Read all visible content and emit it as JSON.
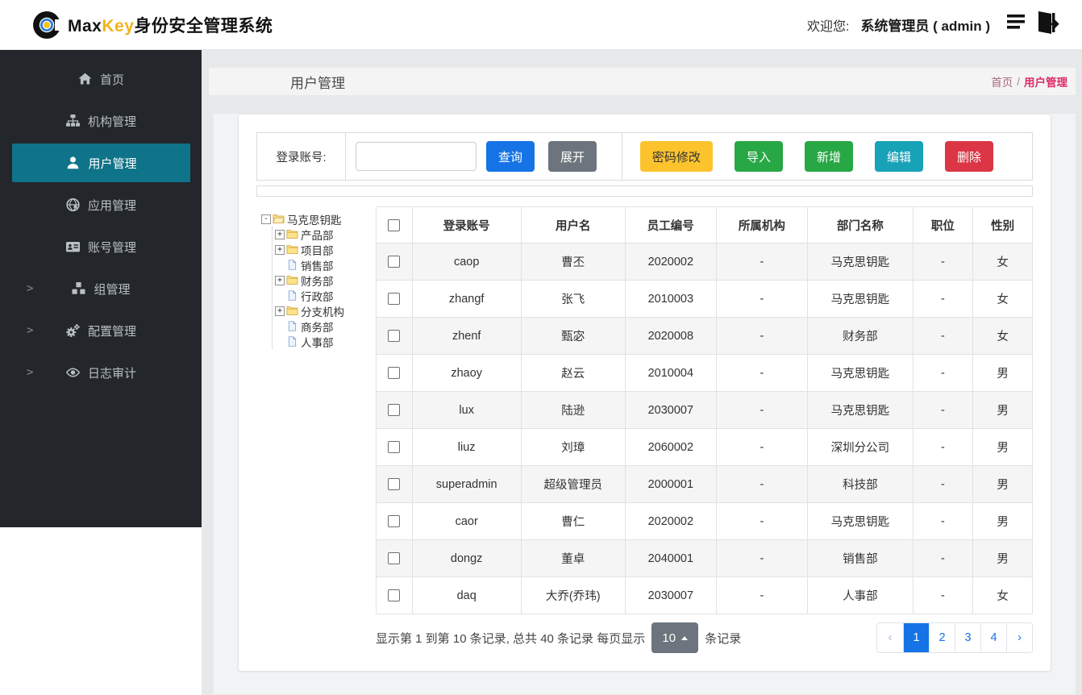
{
  "header": {
    "brand_max": "Max",
    "brand_key": "Key",
    "brand_suffix": "身份安全管理系统",
    "welcome_label": "欢迎您:",
    "user_display": "系统管理员 ( admin )",
    "brand_key_color": "#f2b31c"
  },
  "sidebar": {
    "active_bg": "#0f7489",
    "items": [
      {
        "id": "home",
        "label": "首页",
        "icon": "home-icon",
        "active": false,
        "chevron": false
      },
      {
        "id": "org",
        "label": "机构管理",
        "icon": "sitemap-icon",
        "active": false,
        "chevron": false
      },
      {
        "id": "user",
        "label": "用户管理",
        "icon": "user-icon",
        "active": true,
        "chevron": false
      },
      {
        "id": "app",
        "label": "应用管理",
        "icon": "globe-icon",
        "active": false,
        "chevron": false
      },
      {
        "id": "account",
        "label": "账号管理",
        "icon": "id-card-icon",
        "active": false,
        "chevron": false
      },
      {
        "id": "group",
        "label": "组管理",
        "icon": "cubes-icon",
        "active": false,
        "chevron": true
      },
      {
        "id": "config",
        "label": "配置管理",
        "icon": "gears-icon",
        "active": false,
        "chevron": true
      },
      {
        "id": "audit",
        "label": "日志审计",
        "icon": "eye-icon",
        "active": false,
        "chevron": true
      }
    ]
  },
  "page": {
    "title": "用户管理",
    "breadcrumb": {
      "home": "首页",
      "sep": "/",
      "current": "用户管理",
      "current_color": "#e02a66"
    }
  },
  "search": {
    "label": "登录账号:",
    "input_value": "",
    "query_label": "查询",
    "query_color": "#1673e6",
    "expand_label": "展开",
    "expand_color": "#6c757d",
    "actions": [
      {
        "id": "change-password",
        "label": "密码修改",
        "bg": "#fcc32d",
        "fg": "#333333"
      },
      {
        "id": "import",
        "label": "导入",
        "bg": "#28a745",
        "fg": "#ffffff"
      },
      {
        "id": "add",
        "label": "新增",
        "bg": "#28a745",
        "fg": "#ffffff"
      },
      {
        "id": "edit",
        "label": "编辑",
        "bg": "#17a2b8",
        "fg": "#ffffff"
      },
      {
        "id": "delete",
        "label": "删除",
        "bg": "#dc3545",
        "fg": "#ffffff"
      }
    ]
  },
  "tree": {
    "root": {
      "label": "马克思钥匙",
      "type": "folder-open",
      "toggle": "-"
    },
    "children": [
      {
        "label": "产品部",
        "type": "folder",
        "toggle": "+"
      },
      {
        "label": "项目部",
        "type": "folder",
        "toggle": "+"
      },
      {
        "label": "销售部",
        "type": "file",
        "toggle": ""
      },
      {
        "label": "财务部",
        "type": "folder",
        "toggle": "+"
      },
      {
        "label": "行政部",
        "type": "file",
        "toggle": ""
      },
      {
        "label": "分支机构",
        "type": "folder",
        "toggle": "+"
      },
      {
        "label": "商务部",
        "type": "file",
        "toggle": ""
      },
      {
        "label": "人事部",
        "type": "file",
        "toggle": ""
      }
    ]
  },
  "table": {
    "columns": [
      "登录账号",
      "用户名",
      "员工编号",
      "所属机构",
      "部门名称",
      "职位",
      "性别"
    ],
    "rows": [
      [
        "caop",
        "曹丕",
        "2020002",
        "-",
        "马克思钥匙",
        "-",
        "女"
      ],
      [
        "zhangf",
        "张飞",
        "2010003",
        "-",
        "马克思钥匙",
        "-",
        "女"
      ],
      [
        "zhenf",
        "甄宓",
        "2020008",
        "-",
        "财务部",
        "-",
        "女"
      ],
      [
        "zhaoy",
        "赵云",
        "2010004",
        "-",
        "马克思钥匙",
        "-",
        "男"
      ],
      [
        "lux",
        "陆逊",
        "2030007",
        "-",
        "马克思钥匙",
        "-",
        "男"
      ],
      [
        "liuz",
        "刘璋",
        "2060002",
        "-",
        "深圳分公司",
        "-",
        "男"
      ],
      [
        "superadmin",
        "超级管理员",
        "2000001",
        "-",
        "科技部",
        "-",
        "男"
      ],
      [
        "caor",
        "曹仁",
        "2020002",
        "-",
        "马克思钥匙",
        "-",
        "男"
      ],
      [
        "dongz",
        "董卓",
        "2040001",
        "-",
        "销售部",
        "-",
        "男"
      ],
      [
        "daq",
        "大乔(乔玮)",
        "2030007",
        "-",
        "人事部",
        "-",
        "女"
      ]
    ]
  },
  "footer": {
    "summary_before": "显示第 1 到第 10 条记录, 总共 40 条记录  每页显示",
    "page_size": "10",
    "summary_after": "条记录",
    "prev": "‹",
    "next": "›",
    "pages": [
      "1",
      "2",
      "3",
      "4"
    ],
    "active_page": "1",
    "active_color": "#1673e6"
  }
}
